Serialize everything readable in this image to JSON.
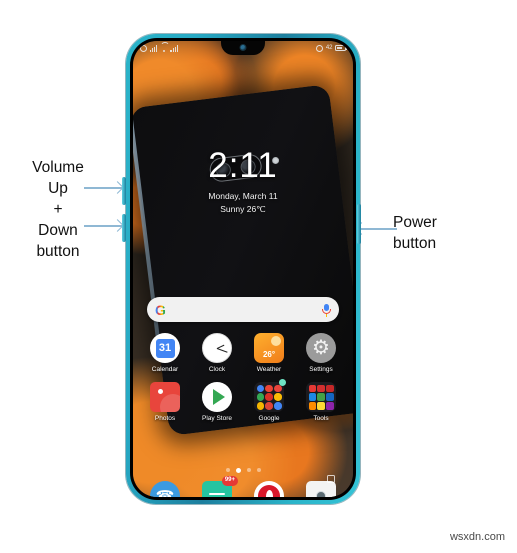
{
  "annotations": {
    "left": {
      "lines": [
        "Volume",
        "Up",
        "+",
        "Down",
        "button"
      ]
    },
    "right": {
      "lines": [
        "Power",
        "button"
      ]
    },
    "arrow_color": "#8fb8d4"
  },
  "phone": {
    "frame_color": "#27a9c4",
    "buttons": [
      {
        "name": "volume-up-button"
      },
      {
        "name": "volume-down-button"
      },
      {
        "name": "power-button"
      }
    ],
    "notch": {
      "camera": "front-camera"
    }
  },
  "statusbar": {
    "left_icons": [
      "alarm-icon",
      "signal-bars-icon",
      "wifi-icon",
      "signal-bars-icon"
    ],
    "right_icons": [
      "alarm-icon",
      "battery-icon"
    ],
    "battery_text": "42"
  },
  "lockwidget": {
    "time": "2:11",
    "date": "Monday, March 11",
    "weather": "Sunny 26℃"
  },
  "search": {
    "logo": "G",
    "placeholder": "",
    "mic_icon": "microphone-icon"
  },
  "home": {
    "rows": [
      [
        {
          "label": "Calendar",
          "icon": "calendar-icon",
          "value": "31"
        },
        {
          "label": "Clock",
          "icon": "clock-icon",
          "value": ""
        },
        {
          "label": "Weather",
          "icon": "weather-icon",
          "value": "26°"
        },
        {
          "label": "Settings",
          "icon": "gear-icon",
          "value": "⚙"
        }
      ],
      [
        {
          "label": "Photos",
          "icon": "photos-icon",
          "value": ""
        },
        {
          "label": "Play Store",
          "icon": "play-store-icon",
          "value": ""
        },
        {
          "label": "Google",
          "icon": "folder-icon",
          "value": ""
        },
        {
          "label": "Tools",
          "icon": "folder-icon",
          "value": ""
        }
      ]
    ],
    "page_dots": {
      "count": 4,
      "active_index": 1
    }
  },
  "dock": [
    {
      "name": "phone-app",
      "label": "Phone",
      "icon": "phone-icon",
      "badge": ""
    },
    {
      "name": "messages-app",
      "label": "Messages",
      "icon": "message-icon",
      "badge": "99+"
    },
    {
      "name": "opera-app",
      "label": "Opera",
      "icon": "opera-icon",
      "badge": ""
    },
    {
      "name": "camera-app",
      "label": "Camera",
      "icon": "camera-icon",
      "badge": ""
    }
  ],
  "navigation": {
    "recents": "recents-square-button"
  },
  "watermark": {
    "text": "wsxdn.com"
  }
}
